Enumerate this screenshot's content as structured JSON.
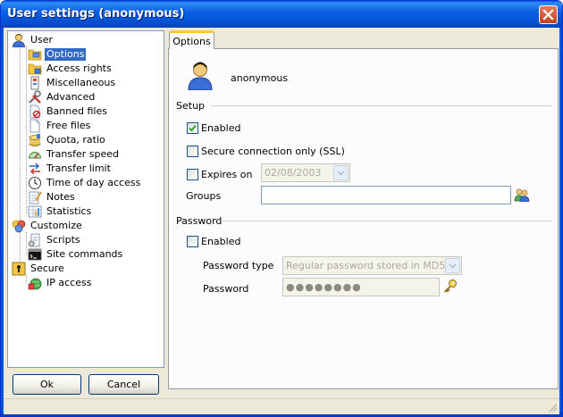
{
  "window": {
    "title": "User settings (anonymous)"
  },
  "tree": {
    "user": {
      "label": "User",
      "children": [
        "Options",
        "Access rights",
        "Miscellaneous",
        "Advanced",
        "Banned files",
        "Free files",
        "Quota, ratio",
        "Transfer speed",
        "Transfer limit",
        "Time of day access",
        "Notes",
        "Statistics"
      ]
    },
    "customize": {
      "label": "Customize",
      "children": [
        "Scripts",
        "Site commands"
      ]
    },
    "secure": {
      "label": "Secure",
      "children": [
        "IP access"
      ]
    },
    "selected": "Options"
  },
  "buttons": {
    "ok": "Ok",
    "cancel": "Cancel"
  },
  "tab": {
    "label": "Options"
  },
  "user": {
    "name": "anonymous"
  },
  "setup": {
    "title": "Setup",
    "enabled": {
      "label": "Enabled",
      "checked": true
    },
    "ssl": {
      "label": "Secure connection only (SSL)",
      "checked": false
    },
    "expires": {
      "label": "Expires on",
      "checked": false,
      "date": "02/08/2003"
    },
    "groups": {
      "label": "Groups",
      "value": ""
    }
  },
  "password": {
    "title": "Password",
    "enabled": {
      "label": "Enabled",
      "checked": false
    },
    "type": {
      "label": "Password type",
      "value": "Regular password stored in MD5"
    },
    "field": {
      "label": "Password",
      "value": "●●●●●●●●"
    }
  },
  "colors": {
    "accent": "#0554D5",
    "selection": "#316AC5",
    "tab_highlight": "#FFC83C"
  }
}
